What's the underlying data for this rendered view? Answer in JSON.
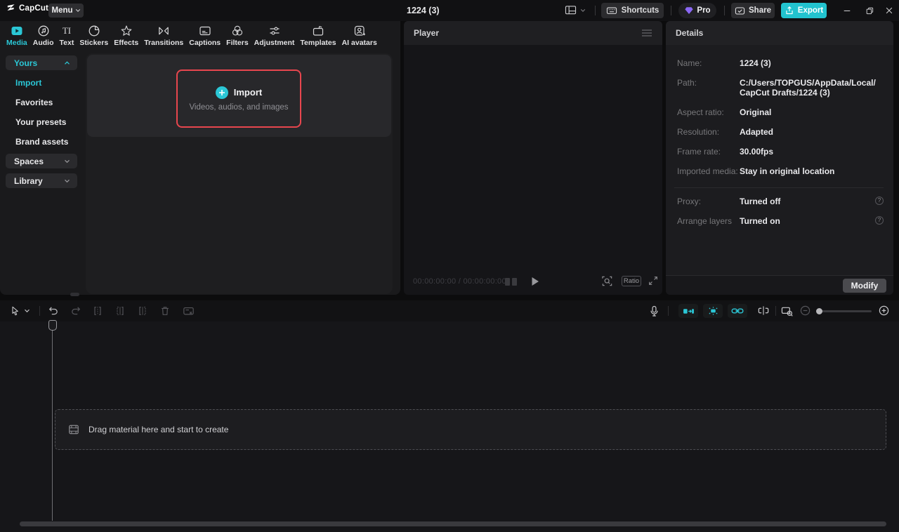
{
  "topbar": {
    "brand": "CapCut",
    "menu_label": "Menu",
    "project_title": "1224 (3)",
    "shortcuts_label": "Shortcuts",
    "pro_label": "Pro",
    "share_label": "Share",
    "export_label": "Export"
  },
  "tabs": [
    "Media",
    "Audio",
    "Text",
    "Stickers",
    "Effects",
    "Transitions",
    "Captions",
    "Filters",
    "Adjustment",
    "Templates",
    "AI avatars"
  ],
  "sidebar": {
    "yours_label": "Yours",
    "items": [
      "Import",
      "Favorites",
      "Your presets",
      "Brand assets"
    ],
    "spaces_label": "Spaces",
    "library_label": "Library"
  },
  "media_panel": {
    "import_title": "Import",
    "import_subtitle": "Videos, audios, and images"
  },
  "player": {
    "title": "Player",
    "timecode": "00:00:00:00 / 00:00:00:00",
    "ratio_label": "Ratio"
  },
  "details": {
    "title": "Details",
    "rows": [
      {
        "label": "Name:",
        "value": "1224 (3)"
      },
      {
        "label": "Path:",
        "value": "C:/Users/TOPGUS/AppData/Local/CapCut Drafts/1224 (3)"
      },
      {
        "label": "Aspect ratio:",
        "value": "Original"
      },
      {
        "label": "Resolution:",
        "value": "Adapted"
      },
      {
        "label": "Frame rate:",
        "value": "30.00fps"
      },
      {
        "label": "Imported media:",
        "value": "Stay in original location"
      }
    ],
    "toggles": [
      {
        "label": "Proxy:",
        "value": "Turned off"
      },
      {
        "label": "Arrange layers",
        "value": "Turned on"
      }
    ],
    "modify_label": "Modify"
  },
  "timeline": {
    "dropzone_text": "Drag material here and start to create"
  },
  "colors": {
    "accent": "#2bc7d6",
    "highlight_red": "#e8464e",
    "pro_purple": "#8b68f5",
    "export_teal": "#22c3cf"
  }
}
